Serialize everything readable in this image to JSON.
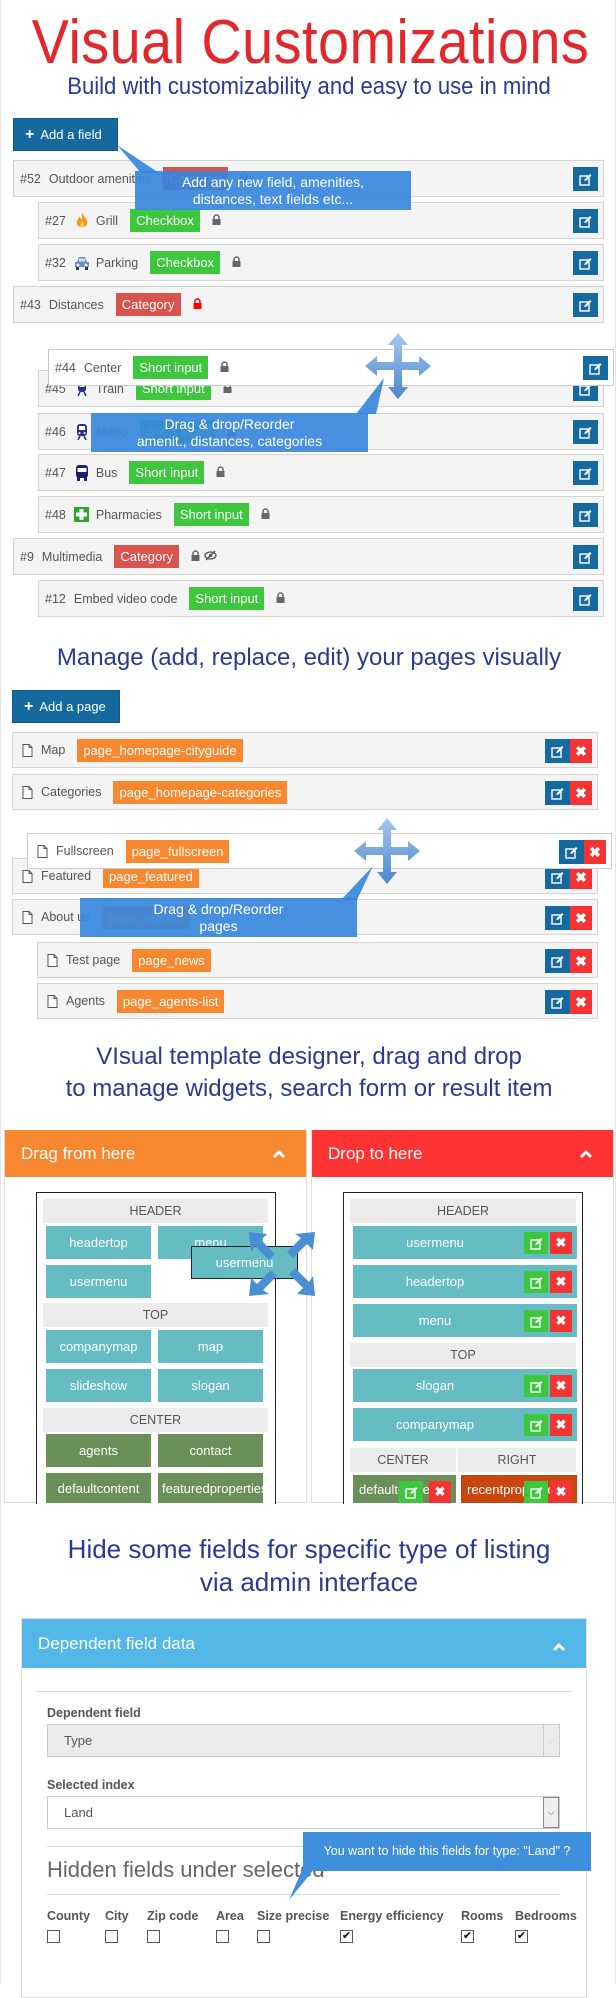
{
  "hero": {
    "title": "Visual Customizations",
    "subtitle": "Build with customizability and easy to use in mind"
  },
  "fields": {
    "add_label": "Add a field",
    "callout": "Add any new field, amenities, distances, text fields etc...",
    "drag_callout": [
      "Drag & drop/Reorder",
      "amenit., distances, categories"
    ],
    "rows": [
      {
        "id": "#52",
        "name": "Outdoor amenities",
        "type": "Category",
        "color": "red",
        "icons": [
          "lock"
        ]
      },
      {
        "id": "#27",
        "name": "Grill",
        "type": "Checkbox",
        "color": "green",
        "icon": "fire-icon",
        "icons": [
          "lock"
        ]
      },
      {
        "id": "#32",
        "name": "Parking",
        "type": "Checkbox",
        "color": "green",
        "icon": "car-icon",
        "icons": [
          "lock"
        ]
      },
      {
        "id": "#43",
        "name": "Distances",
        "type": "Category",
        "color": "red",
        "icons": [
          "lock-red"
        ]
      },
      {
        "id": "#44",
        "name": "Center",
        "type": "Short input",
        "color": "green",
        "icons": [
          "lock"
        ],
        "dragging": true
      },
      {
        "id": "#45",
        "name": "Train",
        "type": "Short input",
        "color": "green",
        "icon": "train-icon",
        "icons": [
          "lock"
        ]
      },
      {
        "id": "#46",
        "name": "Metro",
        "type": "Short input",
        "color": "green",
        "icon": "metro-icon",
        "icons": [
          "lock"
        ]
      },
      {
        "id": "#47",
        "name": "Bus",
        "type": "Short input",
        "color": "green",
        "icon": "bus-icon",
        "icons": [
          "lock"
        ]
      },
      {
        "id": "#48",
        "name": "Pharmacies",
        "type": "Short input",
        "color": "green",
        "icon": "pharmacy-cross-icon",
        "icons": [
          "lock"
        ]
      },
      {
        "id": "#9",
        "name": "Multimedia",
        "type": "Category",
        "color": "red",
        "icons": [
          "lock",
          "eye-slash"
        ]
      },
      {
        "id": "#12",
        "name": "Embed video code",
        "type": "Short input",
        "color": "green",
        "icons": [
          "lock"
        ]
      }
    ]
  },
  "pages": {
    "title": "Manage (add, replace, edit) your pages visually",
    "add_label": "Add a page",
    "drag_callout": [
      "Drag & drop/Reorder",
      "pages"
    ],
    "rows": [
      {
        "name": "Map",
        "template": "page_homepage-cityguide"
      },
      {
        "name": "Categories",
        "template": "page_homepage-categories"
      },
      {
        "name": "Fullscreen",
        "template": "page_fullscreen",
        "dragging": true
      },
      {
        "name": "Featured",
        "template": "page_featured"
      },
      {
        "name": "About us",
        "template": "page_agents"
      },
      {
        "name": "Test page",
        "template": "page_news"
      },
      {
        "name": "Agents",
        "template": "page_agents-list"
      }
    ]
  },
  "designer": {
    "title_lines": [
      "VIsual template designer, drag and drop",
      "to manage widgets, search form or result item"
    ],
    "left": {
      "title": "Drag from here",
      "color": "#f7882f",
      "zones": [
        {
          "label": "HEADER",
          "widgets": [
            "headertop",
            "menu",
            "usermenu"
          ]
        },
        {
          "label": "TOP",
          "widgets": [
            "companymap",
            "map",
            "slideshow",
            "slogan"
          ]
        },
        {
          "label": "CENTER",
          "widgets": [
            "agents",
            "contact",
            "defaultcontent",
            "featuredproperties"
          ]
        }
      ],
      "dragging_widget": "usermenu"
    },
    "right": {
      "title": "Drop to here",
      "color": "#ff3333",
      "zones": [
        {
          "label": "HEADER",
          "widgets": [
            "usermenu",
            "headertop",
            "menu"
          ]
        },
        {
          "label": "TOP",
          "widgets": [
            "slogan",
            "companymap"
          ]
        },
        {
          "label": "CENTER",
          "widgets": [
            "defaultcontent"
          ]
        },
        {
          "label": "RIGHT",
          "widgets": [
            "recentproperties"
          ]
        }
      ]
    }
  },
  "dependent": {
    "title_lines": [
      "Hide some fields for specific type of listing",
      "via admin interface"
    ],
    "panel_title": "Dependent field data",
    "panel_color": "#53b7e8",
    "dependent_field_label": "Dependent field",
    "dependent_field_value": "Type",
    "selected_index_label": "Selected index",
    "selected_index_value": "Land",
    "hidden_heading": "Hidden fields under selected",
    "tooltip": "You want to hide this fields for type: \"Land\" ?",
    "fields": [
      {
        "label": "County",
        "checked": false
      },
      {
        "label": "City",
        "checked": false
      },
      {
        "label": "Zip code",
        "checked": false
      },
      {
        "label": "Area",
        "checked": false
      },
      {
        "label": "Size precise",
        "checked": false
      },
      {
        "label": "Energy efficiency",
        "checked": true
      },
      {
        "label": "Rooms",
        "checked": true
      },
      {
        "label": "Bedrooms",
        "checked": true
      }
    ]
  }
}
